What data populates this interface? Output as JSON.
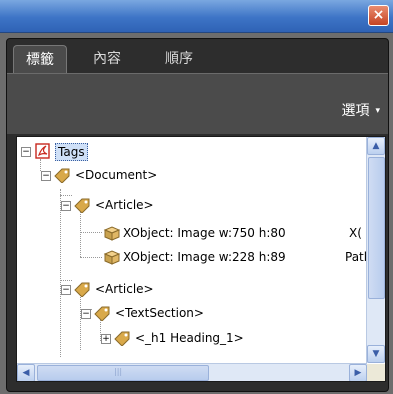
{
  "window": {
    "close_symbol": "×"
  },
  "tabs": [
    {
      "label": "標籤"
    },
    {
      "label": "內容"
    },
    {
      "label": "順序"
    }
  ],
  "options": {
    "label": "選項",
    "arrow": "▾"
  },
  "tree": {
    "root": {
      "label": "Tags"
    },
    "document": {
      "label": "<Document>"
    },
    "article1": {
      "label": "<Article>"
    },
    "xobj1": {
      "label": "XObject:  Image  w:750 h:80",
      "extra": "X("
    },
    "xobj2": {
      "label": "XObject:  Image  w:228 h:89",
      "extra": "Patl"
    },
    "article2": {
      "label": "<Article>"
    },
    "textsection": {
      "label": "<TextSection>"
    },
    "heading": {
      "label": "<_h1 Heading_1>"
    }
  },
  "colors": {
    "titlebar": "#3d74c6",
    "close": "#c64424",
    "selection": "#cfe0f7"
  }
}
